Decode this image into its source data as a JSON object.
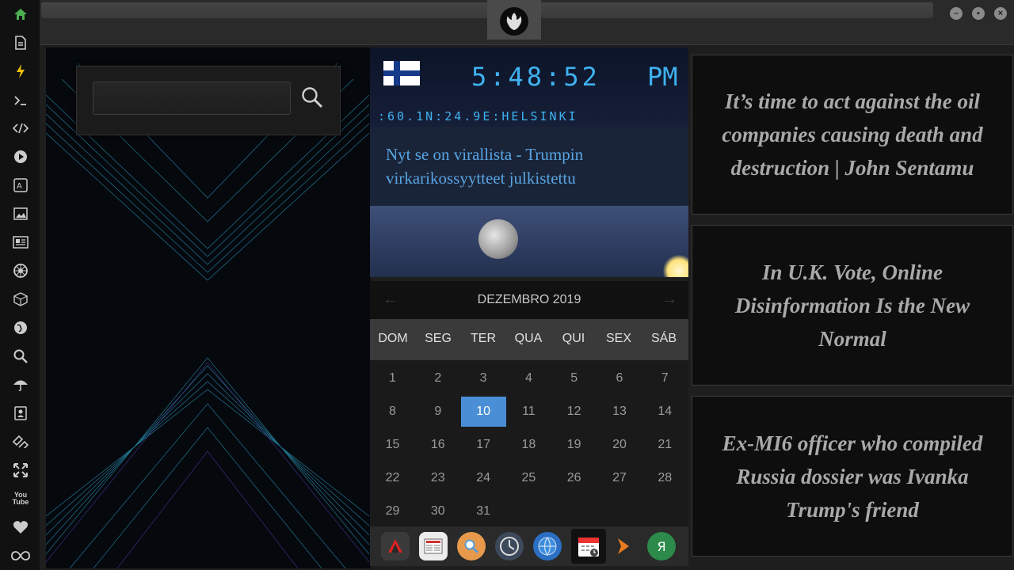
{
  "sidebar": {
    "icons": [
      "home-icon",
      "document-icon",
      "bolt-icon",
      "terminal-icon",
      "code-icon",
      "play-icon",
      "translate-icon",
      "image-icon",
      "newspaper-icon",
      "empire-icon",
      "cube-icon",
      "globe-icon",
      "search-icon",
      "umbrella-icon",
      "contacts-icon",
      "tag-icon",
      "expand-icon",
      "youtube-icon",
      "heart-icon",
      "infinity-icon"
    ],
    "youtube_label": "You Tube"
  },
  "window": {
    "controls": [
      "minimize",
      "maximize",
      "close"
    ]
  },
  "search": {
    "value": "",
    "placeholder": ""
  },
  "clock": {
    "time": "5:48:52",
    "ampm": "PM",
    "location": ":60.1N:24.9E:HELSINKI",
    "country_flag": "Finland"
  },
  "headline": "Nyt se on virallista - Trumpin virkarikossyytteet julkistettu",
  "calendar": {
    "month_label": "DEZEMBRO 2019",
    "weekdays": [
      "DOM",
      "SEG",
      "TER",
      "QUA",
      "QUI",
      "SEX",
      "SÁB"
    ],
    "weeks": [
      [
        "1",
        "2",
        "3",
        "4",
        "5",
        "6",
        "7"
      ],
      [
        "8",
        "9",
        "10",
        "11",
        "12",
        "13",
        "14"
      ],
      [
        "15",
        "16",
        "17",
        "18",
        "19",
        "20",
        "21"
      ],
      [
        "22",
        "23",
        "24",
        "25",
        "26",
        "27",
        "28"
      ],
      [
        "29",
        "30",
        "31"
      ]
    ],
    "today": "10"
  },
  "dock": [
    "app-launcher",
    "news-reader",
    "search",
    "clock",
    "browser",
    "calendar",
    "media-player",
    "yandex"
  ],
  "dock_letter": "Я",
  "news_items": [
    "It’s time to act against the oil companies causing death and destruction | John Sentamu",
    "In U.K. Vote, Online Disinformation Is the New Normal",
    "Ex-MI6 officer who compiled Russia dossier was Ivanka Trump's friend"
  ],
  "colors": {
    "accent": "#3fb2f0",
    "today": "#4a8fd6",
    "headline": "#58a4e2"
  }
}
